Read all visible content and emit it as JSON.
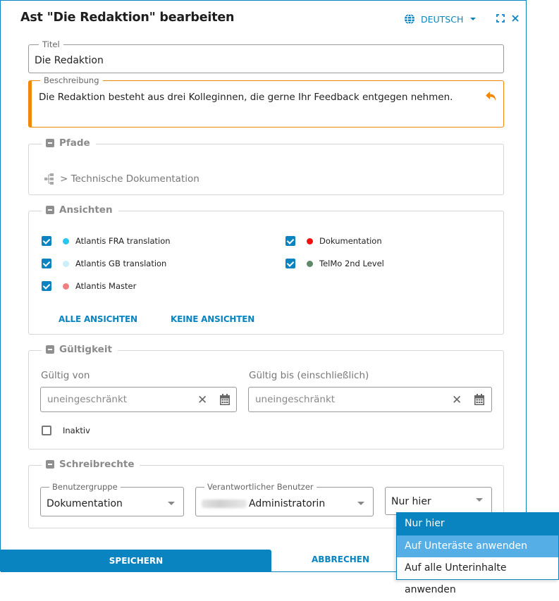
{
  "dialog": {
    "title": "Ast \"Die Redaktion\" bearbeiten",
    "language": "DEUTSCH",
    "accent_color": "#0a84c0"
  },
  "fields": {
    "titel": {
      "label": "Titel",
      "value": "Die Redaktion"
    },
    "beschreibung": {
      "label": "Beschreibung",
      "value": "Die Redaktion besteht aus drei Kolleginnen, die gerne Ihr Feedback entgegen nehmen.",
      "modified_color": "#f0880a"
    }
  },
  "pfade": {
    "legend": "Pfade",
    "path": "> Technische Dokumentation"
  },
  "ansichten": {
    "legend": "Ansichten",
    "items": [
      {
        "label": "Atlantis FRA translation",
        "checked": true,
        "color": "#29c6f0"
      },
      {
        "label": "Atlantis GB translation",
        "checked": true,
        "color": "#c9f0fa"
      },
      {
        "label": "Atlantis Master",
        "checked": true,
        "color": "#f08080"
      },
      {
        "label": "Dokumentation",
        "checked": true,
        "color": "#f01010"
      },
      {
        "label": "TelMo 2nd Level",
        "checked": true,
        "color": "#5e8a6a"
      }
    ],
    "all_label": "ALLE ANSICHTEN",
    "none_label": "KEINE ANSICHTEN"
  },
  "gueltigkeit": {
    "legend": "Gültigkeit",
    "from_label": "Gültig von",
    "from_placeholder": "uneingeschränkt",
    "to_label": "Gültig bis (einschließlich)",
    "to_placeholder": "uneingeschränkt",
    "inactive_label": "Inaktiv",
    "inactive_checked": false
  },
  "schreibrechte": {
    "legend": "Schreibrechte",
    "group_label": "Benutzergruppe",
    "group_value": "Dokumentation",
    "user_label": "Verantwortlicher Benutzer",
    "user_value": "Administratorin",
    "scope_value": "Nur hier",
    "scope_options": [
      {
        "label": "Nur hier",
        "state": "selected"
      },
      {
        "label": "Auf Unteräste anwenden",
        "state": "hover"
      },
      {
        "label": "Auf alle Unterinhalte anwenden",
        "state": "normal"
      }
    ]
  },
  "footer": {
    "save_label": "SPEICHERN",
    "cancel_label": "ABBRECHEN"
  }
}
